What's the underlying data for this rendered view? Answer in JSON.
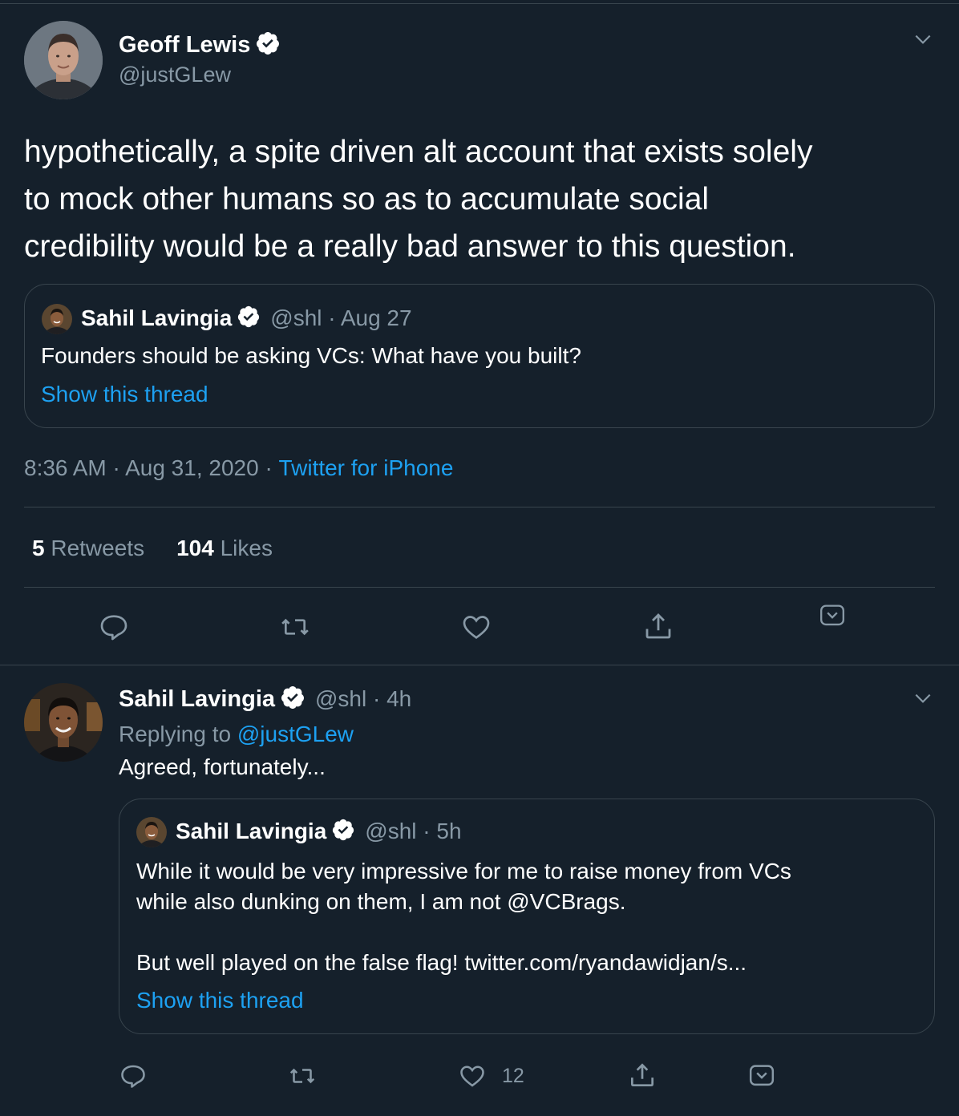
{
  "main_tweet": {
    "author_name": "Geoff Lewis",
    "author_handle": "@justGLew",
    "text_lines": [
      "hypothetically, a spite driven alt account that exists solely",
      "to mock other humans so as to accumulate social",
      "credibility would be a really bad answer to this question."
    ],
    "quoted": {
      "author_name": "Sahil Lavingia",
      "meta": "@shl · Aug 27",
      "text": "Founders should be asking VCs: What have you built?",
      "show_thread": "Show this thread"
    },
    "timestamp": "8:36 AM · Aug 31, 2020 · ",
    "source": "Twitter for iPhone",
    "retweets_count": "5",
    "retweets_label": "Retweets",
    "likes_count": "104",
    "likes_label": "Likes"
  },
  "reply": {
    "author_name": "Sahil Lavingia",
    "meta": "@shl · 4h",
    "replying_to_label": "Replying to ",
    "replying_to_handle": "@justGLew",
    "text": "Agreed, fortunately...",
    "quoted": {
      "author_name": "Sahil Lavingia",
      "meta": "@shl · 5h",
      "text_lines": [
        "While it would be very impressive for me to raise money from VCs",
        "while also dunking on them, I am not @VCBrags.",
        "But well played on the false flag! twitter.com/ryandawidjan/s..."
      ],
      "show_thread": "Show this thread"
    },
    "like_count": "12"
  },
  "icons": [
    "chevron-down-icon",
    "verified-badge-icon",
    "reply-icon",
    "retweet-icon",
    "like-icon",
    "share-icon",
    "bookmark-icon"
  ],
  "colors": {
    "background": "#15202b",
    "border": "#38444d",
    "muted": "#8899a6",
    "accent": "#1da1f2"
  }
}
